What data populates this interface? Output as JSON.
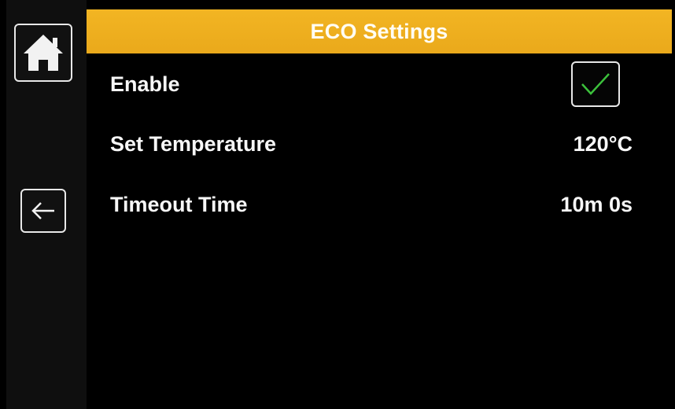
{
  "header": {
    "title": "ECO Settings"
  },
  "sidebar": {
    "home_icon": "home-icon",
    "back_icon": "arrow-left-icon"
  },
  "settings": {
    "enable": {
      "label": "Enable",
      "checked": true
    },
    "set_temperature": {
      "label": "Set Temperature",
      "value": "120°C"
    },
    "timeout_time": {
      "label": "Timeout Time",
      "value": "10m 0s"
    }
  },
  "colors": {
    "accent": "#eeb020",
    "check": "#3cc13c",
    "background": "#000000"
  }
}
